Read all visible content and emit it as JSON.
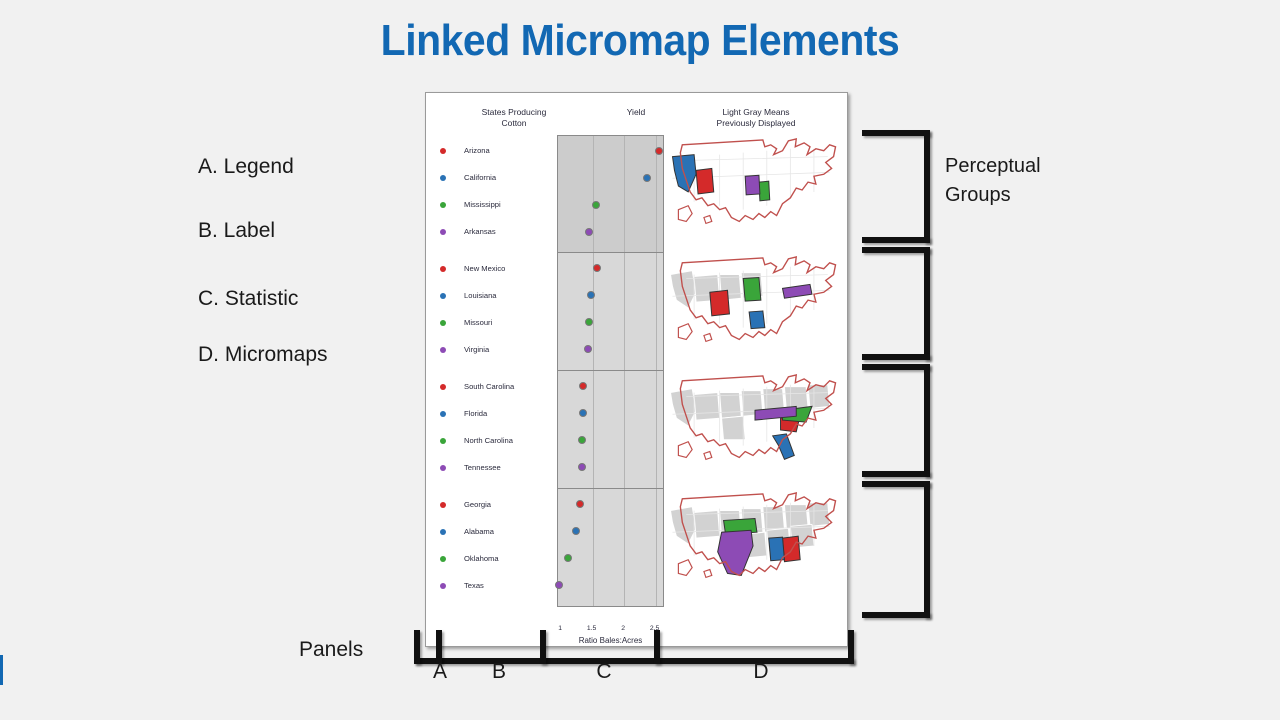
{
  "slide": {
    "title": "Linked Micromap Elements",
    "title_color": "#1268b3",
    "background_color": "#f1f1f1"
  },
  "key_list": [
    {
      "label": "A. Legend"
    },
    {
      "label": "B. Label"
    },
    {
      "label": "C. Statistic"
    },
    {
      "label": "D. Micromaps"
    }
  ],
  "annotations": {
    "perceptual_groups": "Perceptual\nGroups",
    "perceptual_groups_line1": "Perceptual",
    "perceptual_groups_line2": "Groups",
    "panels": "Panels",
    "panel_letters": [
      "A",
      "B",
      "C",
      "D"
    ]
  },
  "figure": {
    "headers": {
      "label_col_line1": "States Producing",
      "label_col_line2": "Cotton",
      "stat_col": "Yield",
      "map_col_line1": "Light Gray Means",
      "map_col_line2": "Previously Displayed"
    },
    "series_colors": {
      "red": "#d42a2a",
      "blue": "#2a72b5",
      "green": "#3aa53a",
      "purple": "#8d4bb5"
    },
    "map_outline_color": "#c0504d",
    "map_previous_fill": "#d2d2d2",
    "panel_fill": "#d8d8d8"
  },
  "chart_data": {
    "type": "scatter",
    "title": "States Producing Cotton",
    "xlabel": "Ratio Bales:Acres",
    "ylabel": "",
    "xticks": [
      "1",
      "1.5",
      "2",
      "2.5"
    ],
    "xlim": [
      0.95,
      2.65
    ],
    "grid": true,
    "legend_position": "left-column",
    "note": "Light Gray Means Previously Displayed",
    "perceptual_groups": [
      {
        "group": 1,
        "highlighted": true,
        "rows": [
          {
            "label": "Arizona",
            "color": "red",
            "value": 2.55
          },
          {
            "label": "California",
            "color": "blue",
            "value": 2.36
          },
          {
            "label": "Mississippi",
            "color": "green",
            "value": 1.56
          },
          {
            "label": "Arkansas",
            "color": "purple",
            "value": 1.45
          }
        ]
      },
      {
        "group": 2,
        "highlighted": false,
        "rows": [
          {
            "label": "New Mexico",
            "color": "red",
            "value": 1.57
          },
          {
            "label": "Louisiana",
            "color": "blue",
            "value": 1.47
          },
          {
            "label": "Missouri",
            "color": "green",
            "value": 1.44
          },
          {
            "label": "Virginia",
            "color": "purple",
            "value": 1.42
          }
        ]
      },
      {
        "group": 3,
        "highlighted": false,
        "rows": [
          {
            "label": "South Carolina",
            "color": "red",
            "value": 1.35
          },
          {
            "label": "Florida",
            "color": "blue",
            "value": 1.34
          },
          {
            "label": "North Carolina",
            "color": "green",
            "value": 1.33
          },
          {
            "label": "Tennessee",
            "color": "purple",
            "value": 1.33
          }
        ]
      },
      {
        "group": 4,
        "highlighted": false,
        "rows": [
          {
            "label": "Georgia",
            "color": "red",
            "value": 1.3
          },
          {
            "label": "Alabama",
            "color": "blue",
            "value": 1.24
          },
          {
            "label": "Oklahoma",
            "color": "green",
            "value": 1.11
          },
          {
            "label": "Texas",
            "color": "purple",
            "value": 0.97
          }
        ]
      }
    ]
  }
}
